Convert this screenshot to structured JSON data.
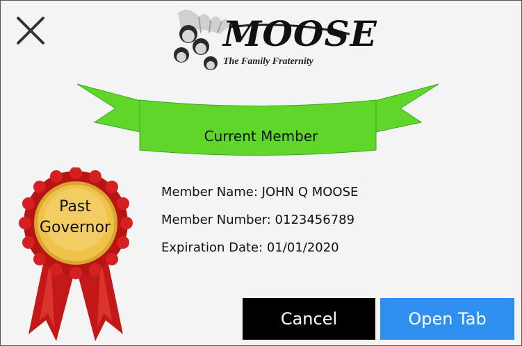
{
  "logo": {
    "word": "MOOSE",
    "tagline": "The Family Fraternity"
  },
  "status": {
    "label": "Current Member",
    "banner_color": "#5fd62a"
  },
  "award": {
    "line1": "Past",
    "line2": "Governor",
    "ribbon_color": "#cc1a1a",
    "medal_color": "#f0c24a"
  },
  "member": {
    "name": "Member Name: JOHN Q MOOSE",
    "number": "Member Number: 0123456789",
    "expiration": "Expiration Date: 01/01/2020"
  },
  "actions": {
    "cancel_label": "Cancel",
    "open_label": "Open Tab"
  },
  "icons": {
    "close": "close-icon"
  }
}
